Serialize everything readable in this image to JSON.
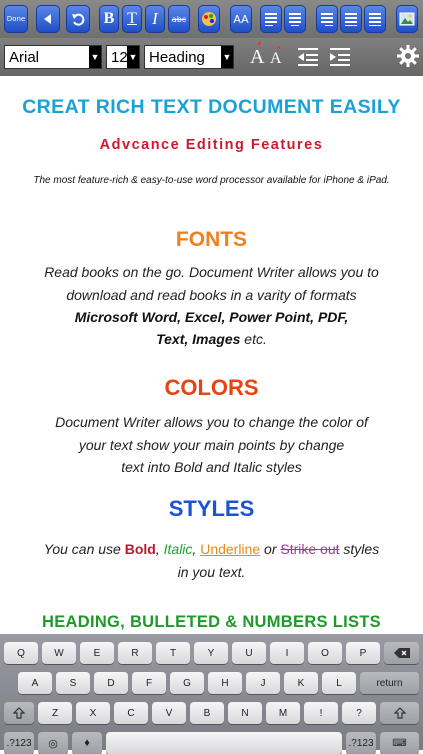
{
  "toolbar": {
    "done_label": "Done",
    "font_name": "Arial",
    "font_size": "12",
    "style_name": "Heading",
    "abc_label": "abc",
    "aa_label": "AA",
    "bold_label": "B",
    "italic_label": "I",
    "underline_label": "T"
  },
  "document": {
    "title": "CREAT RICH TEXT DOCUMENT EASILY",
    "subtitle": "Advcance Editing Features",
    "tagline": "The most feature-rich & easy-to-use word processor available for iPhone & iPad.",
    "fonts_heading": "FONTS",
    "fonts_line1": "Read books on the go. Document Writer allows you to",
    "fonts_line2": "download and read books in a varity of formats",
    "fonts_line3": "Microsoft Word, Excel, Power Point, PDF,",
    "fonts_line4_bold": "Text, Images",
    "fonts_line4_rest": " etc.",
    "colors_heading": "COLORS",
    "colors_line1": "Document Writer allows you to change the color of",
    "colors_line2": "your text show your main points by change",
    "colors_line3": "text into Bold and Italic styles",
    "styles_heading": "STYLES",
    "styles_prefix": "You can use ",
    "styles_bold": "Bold",
    "styles_sep1": ", ",
    "styles_italic": "Italic",
    "styles_sep2": ", ",
    "styles_underline": "Underline",
    "styles_or": " or ",
    "styles_strike": "Strike out",
    "styles_suffix": "  styles",
    "styles_line2": "in you text.",
    "lists_heading": "HEADING, BULLETED & NUMBERS LISTS"
  },
  "keyboard": {
    "row1": [
      "Q",
      "W",
      "E",
      "R",
      "T",
      "Y",
      "U",
      "I",
      "O",
      "P"
    ],
    "row2": [
      "A",
      "S",
      "D",
      "F",
      "G",
      "H",
      "J",
      "K",
      "L"
    ],
    "row3": [
      "Z",
      "X",
      "C",
      "V",
      "B",
      "N",
      "M",
      "!",
      "?"
    ],
    "return_label": "return",
    "numbers_label": ".?123"
  },
  "colors": {
    "title": "#1aa1d6",
    "subtitle": "#d0192e",
    "fonts_heading": "#f08020",
    "colors_heading": "#e84412",
    "styles_heading": "#1c52d8",
    "lists_heading": "#1d9a2a",
    "bold_word": "#c0182a",
    "italic_word": "#1ea12e",
    "underline_word": "#e58a1c",
    "strike_word": "#9b3b9e"
  }
}
